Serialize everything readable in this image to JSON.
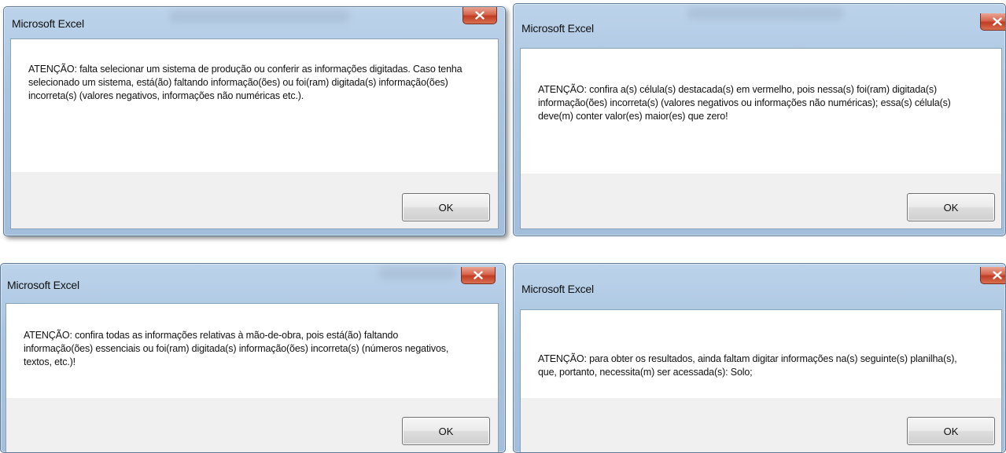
{
  "colors": {
    "titlebar": "#a9c4e0",
    "close_button": "#c13c23",
    "client_background": "#ffffff",
    "footer_background": "#f0f0f0"
  },
  "dialogs": [
    {
      "title": "Microsoft Excel",
      "close_icon": "close-icon",
      "message": "ATENÇÃO: falta selecionar um sistema de produção ou conferir as informações digitadas. Caso tenha selecionado um sistema, está(ão) faltando informação(ões) ou foi(ram) digitada(s) informação(ões) incorreta(s) (valores negativos, informações não numéricas etc.).",
      "ok_label": "OK"
    },
    {
      "title": "Microsoft Excel",
      "close_icon": "close-icon",
      "message": "ATENÇÃO: confira a(s) célula(s) destacada(s) em vermelho, pois nessa(s) foi(ram) digitada(s) informação(ões) incorreta(s) (valores negativos ou informações não numéricas); essa(s) célula(s) deve(m) conter valor(es) maior(es) que zero!",
      "ok_label": "OK"
    },
    {
      "title": "Microsoft Excel",
      "close_icon": "close-icon",
      "message": "ATENÇÃO: confira todas as informações relativas à mão-de-obra, pois está(ão) faltando informação(ões) essenciais ou foi(ram) digitada(s) informação(ões) incorreta(s) (números negativos, textos, etc.)!",
      "ok_label": "OK"
    },
    {
      "title": "Microsoft Excel",
      "close_icon": "close-icon",
      "message": "ATENÇÃO: para obter os resultados, ainda faltam digitar informações na(s) seguinte(s) planilha(s), que, portanto, necessita(m) ser acessada(s):  Solo;",
      "ok_label": "OK"
    }
  ]
}
